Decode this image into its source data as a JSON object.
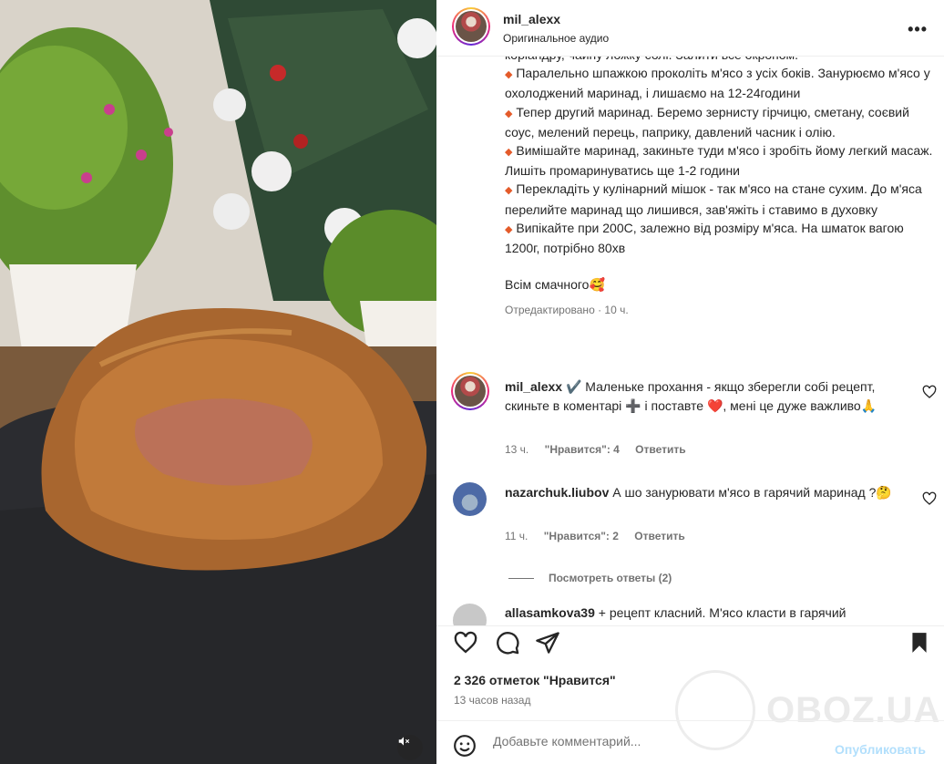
{
  "post": {
    "username": "mil_alexx",
    "audio": "Оригинальное аудио",
    "more_icon": "more-horizontal-icon"
  },
  "caption": {
    "lines": [
      "коріандру, чайну ложку солі. Залити все окропом.",
      "Паралельно шпажкою проколіть м'ясо з усіх боків. Занурюємо м'ясо у охолоджений маринад, і лишаємо на 12-24години",
      "Тепер другий маринад. Беремо зернисту гірчицю, сметану, соєвий соус, мелений перець, паприку, давлений часник і олію.",
      "Вимішайте маринад, закиньте туди м'ясо і зробіть йому легкий масаж. Лишіть промаринуватись ще 1-2 години",
      "Перекладіть у кулінарний мішок - так м'ясо на стане сухим. До м'яса перелийте маринад що лишився, зав'яжіть і ставимо в духовку",
      "Випікайте при 200С, залежно від розміру м'яса. На шматок вагою 1200г, потрібно 80хв"
    ],
    "closing": "Всім смачного🥰",
    "edited": "Отредактировано · 10 ч."
  },
  "comments": [
    {
      "user": "mil_alexx",
      "text": "✔️ Маленьке прохання - якщо зберегли собі рецепт, скиньте в коментарі ➕ і поставте ❤️, мені це дуже важливо🙏",
      "time": "13 ч.",
      "likes": "\"Нравится\": 4",
      "reply": "Ответить"
    },
    {
      "user": "nazarchuk.liubov",
      "text": "А шо занурювати м'ясо в гарячий маринад ?🤔",
      "time": "11 ч.",
      "likes": "\"Нравится\": 2",
      "reply": "Ответить",
      "thread": "Посмотреть ответы (2)"
    },
    {
      "user": "allasamkova39",
      "text": "+ рецепт класний. М'ясо класти в гарячий"
    }
  ],
  "footer": {
    "likes": "2 326 отметок \"Нравится\"",
    "time": "13 часов назад",
    "comment_placeholder": "Добавьте комментарий...",
    "publish": "Опубликовать"
  },
  "watermark": "OBOZ.UA",
  "colors": {
    "link_blue_disabled": "#b2dffc",
    "bullet": "#e45b2a",
    "verified": "#7b5fd6"
  }
}
